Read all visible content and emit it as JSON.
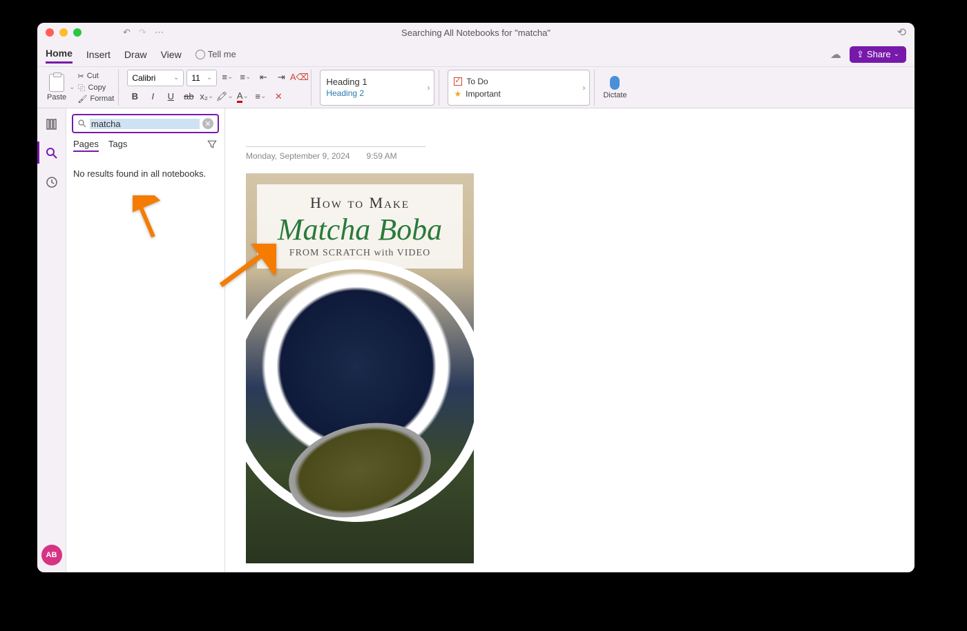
{
  "titlebar": {
    "title": "Searching All Notebooks for \"matcha\""
  },
  "tabs": {
    "home": "Home",
    "insert": "Insert",
    "draw": "Draw",
    "view": "View",
    "tellme": "Tell me"
  },
  "share_button": "Share",
  "ribbon": {
    "paste": "Paste",
    "cut": "Cut",
    "copy": "Copy",
    "format": "Format",
    "font_name": "Calibri",
    "font_size": "11",
    "heading1": "Heading 1",
    "heading2": "Heading 2",
    "todo": "To Do",
    "important": "Important",
    "dictate": "Dictate"
  },
  "search": {
    "value": "matcha",
    "tab_pages": "Pages",
    "tab_tags": "Tags",
    "no_results": "No results found in all notebooks."
  },
  "note": {
    "date": "Monday, September 9, 2024",
    "time": "9:59 AM",
    "image_title_1": "How to Make",
    "image_title_2": "Matcha Boba",
    "image_title_3": "FROM SCRATCH with VIDEO"
  },
  "avatar": "AB"
}
